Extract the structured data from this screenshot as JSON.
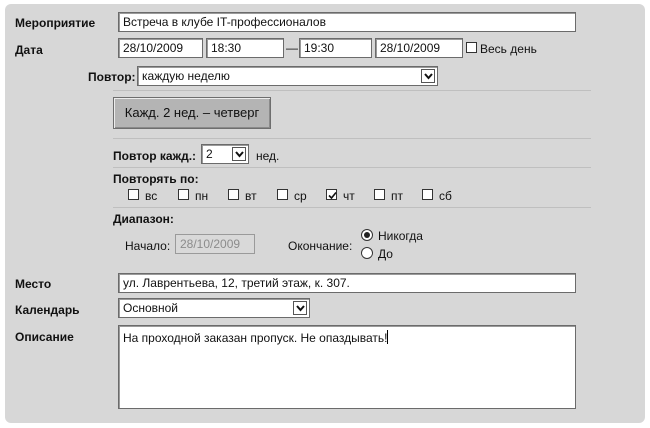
{
  "event": {
    "label": "Мероприятие",
    "value": "Встреча в клубе IT-профессионалов"
  },
  "date": {
    "label": "Дата",
    "start_date": "28/10/2009",
    "start_time": "18:30",
    "dash": "—",
    "end_time": "19:30",
    "end_date": "28/10/2009",
    "all_day_label": "Весь день",
    "all_day_checked": false
  },
  "repeat": {
    "label": "Повтор:",
    "value": "каждую неделю",
    "summary": "Кажд. 2 нед. – четверг",
    "every_label": "Повтор кажд.:",
    "every_value": "2",
    "every_unit": "нед.",
    "on_label": "Повторять по:",
    "days": [
      {
        "label": "вс",
        "checked": false
      },
      {
        "label": "пн",
        "checked": false
      },
      {
        "label": "вт",
        "checked": false
      },
      {
        "label": "ср",
        "checked": false
      },
      {
        "label": "чт",
        "checked": true
      },
      {
        "label": "пт",
        "checked": false
      },
      {
        "label": "сб",
        "checked": false
      }
    ],
    "range_label": "Диапазон:",
    "start_label": "Начало:",
    "start_value": "28/10/2009",
    "end_label": "Окончание:",
    "end_options": [
      {
        "label": "Никогда",
        "selected": true
      },
      {
        "label": "До",
        "selected": false
      }
    ]
  },
  "location": {
    "label": "Место",
    "value": "ул. Лаврентьева, 12, третий этаж, к. 307."
  },
  "calendar": {
    "label": "Календарь",
    "value": "Основной"
  },
  "description": {
    "label": "Описание",
    "value": "На проходной заказан пропуск. Не опаздывать!"
  }
}
